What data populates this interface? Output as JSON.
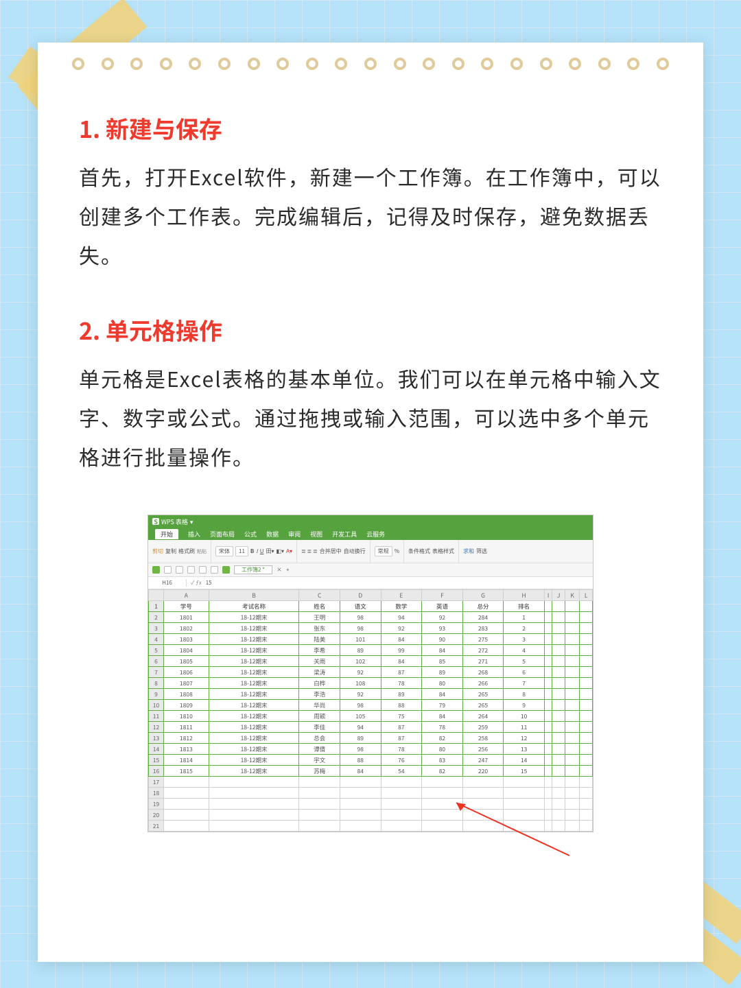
{
  "section1": {
    "title": "1. 新建与保存",
    "body": "首先，打开Excel软件，新建一个工作簿。在工作簿中，可以创建多个工作表。完成编辑后，记得及时保存，避免数据丢失。"
  },
  "section2": {
    "title": "2. 单元格操作",
    "body": "单元格是Excel表格的基本单位。我们可以在单元格中输入文字、数字或公式。通过拖拽或输入范围，可以选中多个单元格进行批量操作。"
  },
  "app": {
    "name": "WPS 表格",
    "tabs": [
      "开始",
      "插入",
      "页面布局",
      "公式",
      "数据",
      "审阅",
      "视图",
      "开发工具",
      "云服务"
    ],
    "active_tab": "开始",
    "ribbon": {
      "clip": {
        "cut": "剪切",
        "copy": "复制",
        "fmtbrush": "格式刷",
        "paste": "粘贴"
      },
      "font": {
        "name": "宋体",
        "size": "11"
      },
      "align": {
        "merge": "合并居中",
        "wrap": "自动换行"
      },
      "number": {
        "fmt": "常规"
      },
      "styles": {
        "cond": "条件格式",
        "table": "表格样式"
      },
      "calc": {
        "sum": "求和",
        "filter": "筛选"
      }
    },
    "sheet_tab": "工作簿2",
    "cell_ref": "H16",
    "fx_value": "15",
    "cols": [
      "A",
      "B",
      "C",
      "D",
      "E",
      "F",
      "G",
      "H",
      "I",
      "J",
      "K",
      "L"
    ],
    "headers": [
      "学号",
      "考试名称",
      "姓名",
      "语文",
      "数学",
      "英语",
      "总分",
      "排名"
    ],
    "rows": [
      [
        "1801",
        "18-12期末",
        "王明",
        "98",
        "94",
        "92",
        "284",
        "1"
      ],
      [
        "1802",
        "18-12期末",
        "张东",
        "98",
        "92",
        "93",
        "283",
        "2"
      ],
      [
        "1803",
        "18-12期末",
        "陆美",
        "101",
        "84",
        "90",
        "275",
        "3"
      ],
      [
        "1804",
        "18-12期末",
        "李希",
        "89",
        "99",
        "84",
        "272",
        "4"
      ],
      [
        "1805",
        "18-12期末",
        "关雨",
        "102",
        "84",
        "85",
        "271",
        "5"
      ],
      [
        "1806",
        "18-12期末",
        "梁涛",
        "92",
        "87",
        "89",
        "268",
        "6"
      ],
      [
        "1807",
        "18-12期末",
        "白桦",
        "108",
        "78",
        "80",
        "266",
        "7"
      ],
      [
        "1808",
        "18-12期末",
        "李浩",
        "92",
        "89",
        "84",
        "265",
        "8"
      ],
      [
        "1809",
        "18-12期末",
        "华尚",
        "98",
        "88",
        "79",
        "265",
        "9"
      ],
      [
        "1810",
        "18-12期末",
        "周颖",
        "105",
        "75",
        "84",
        "264",
        "10"
      ],
      [
        "1811",
        "18-12期末",
        "李佳",
        "94",
        "87",
        "78",
        "259",
        "11"
      ],
      [
        "1812",
        "18-12期末",
        "总会",
        "89",
        "87",
        "82",
        "258",
        "12"
      ],
      [
        "1813",
        "18-12期末",
        "谭倩",
        "98",
        "78",
        "80",
        "256",
        "13"
      ],
      [
        "1814",
        "18-12期末",
        "宇文",
        "88",
        "76",
        "83",
        "247",
        "14"
      ],
      [
        "1815",
        "18-12期末",
        "苏梅",
        "84",
        "54",
        "82",
        "220",
        "15"
      ]
    ],
    "blank_rows": [
      17,
      18,
      19,
      20,
      21
    ]
  }
}
